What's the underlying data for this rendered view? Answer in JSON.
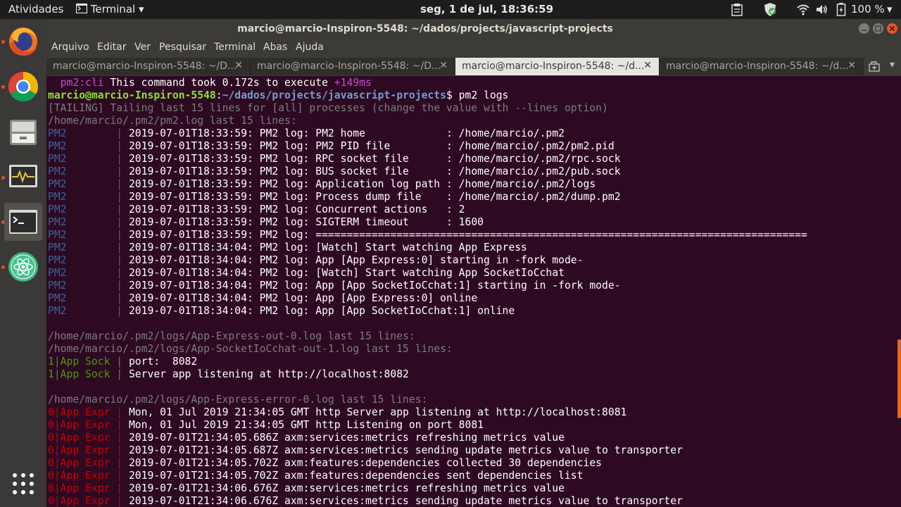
{
  "topbar": {
    "activities": "Atividades",
    "app_menu": "Terminal",
    "app_menu_arrow": "▾",
    "clock": "seg,  1 de jul, 18:36:59",
    "battery": "100 %",
    "tray_arrow": "▾"
  },
  "window": {
    "title": "marcio@marcio-Inspiron-5548: ~/dados/projects/javascript-projects"
  },
  "menu": [
    "Arquivo",
    "Editar",
    "Ver",
    "Pesquisar",
    "Terminal",
    "Abas",
    "Ajuda"
  ],
  "tabs": [
    {
      "label": "marcio@marcio-Inspiron-5548: ~/D...",
      "close": "✕"
    },
    {
      "label": "marcio@marcio-Inspiron-5548: ~/D...",
      "close": "✕"
    },
    {
      "label": "marcio@marcio-Inspiron-5548: ~/d...",
      "close": "✕"
    },
    {
      "label": "marcio@marcio-Inspiron-5548: ~/d...",
      "close": "✕"
    }
  ],
  "tabbar_menu_arrow": "▾",
  "colors": {
    "white": "#ffffff",
    "text": "#d3d7cf",
    "gray": "#7d7d7d",
    "blue": "#3465a4",
    "green": "#4e9a06",
    "red": "#cc0000",
    "magenta": "#c94ad3",
    "prompt_user": "#8ae234",
    "prompt_path": "#729fcf"
  },
  "terminal_lines": [
    [
      {
        "t": "  pm2:cli",
        "c": "magenta"
      },
      {
        "t": " This command took 0.172s to execute ",
        "c": "white"
      },
      {
        "t": "+149ms",
        "c": "magenta"
      }
    ],
    [
      {
        "t": "marcio@marcio-Inspiron-5548",
        "c": "prompt_user"
      },
      {
        "t": ":",
        "c": "white"
      },
      {
        "t": "~/dados/projects/javascript-projects",
        "c": "prompt_path"
      },
      {
        "t": "$ pm2 logs",
        "c": "white"
      }
    ],
    [
      {
        "t": "[TAILING] Tailing last 15 lines for [all] processes (change the value with --lines option)",
        "c": "gray"
      }
    ],
    [
      {
        "t": "/home/marcio/.pm2/pm2.log last 15 lines:",
        "c": "gray"
      }
    ],
    [
      {
        "t": "PM2        ",
        "c": "blue"
      },
      {
        "t": "| ",
        "c": "blue"
      },
      {
        "t": "2019-07-01T18:33:59: PM2 log: PM2 home             : /home/marcio/.pm2",
        "c": "white"
      }
    ],
    [
      {
        "t": "PM2        ",
        "c": "blue"
      },
      {
        "t": "| ",
        "c": "blue"
      },
      {
        "t": "2019-07-01T18:33:59: PM2 log: PM2 PID file         : /home/marcio/.pm2/pm2.pid",
        "c": "white"
      }
    ],
    [
      {
        "t": "PM2        ",
        "c": "blue"
      },
      {
        "t": "| ",
        "c": "blue"
      },
      {
        "t": "2019-07-01T18:33:59: PM2 log: RPC socket file      : /home/marcio/.pm2/rpc.sock",
        "c": "white"
      }
    ],
    [
      {
        "t": "PM2        ",
        "c": "blue"
      },
      {
        "t": "| ",
        "c": "blue"
      },
      {
        "t": "2019-07-01T18:33:59: PM2 log: BUS socket file      : /home/marcio/.pm2/pub.sock",
        "c": "white"
      }
    ],
    [
      {
        "t": "PM2        ",
        "c": "blue"
      },
      {
        "t": "| ",
        "c": "blue"
      },
      {
        "t": "2019-07-01T18:33:59: PM2 log: Application log path : /home/marcio/.pm2/logs",
        "c": "white"
      }
    ],
    [
      {
        "t": "PM2        ",
        "c": "blue"
      },
      {
        "t": "| ",
        "c": "blue"
      },
      {
        "t": "2019-07-01T18:33:59: PM2 log: Process dump file    : /home/marcio/.pm2/dump.pm2",
        "c": "white"
      }
    ],
    [
      {
        "t": "PM2        ",
        "c": "blue"
      },
      {
        "t": "| ",
        "c": "blue"
      },
      {
        "t": "2019-07-01T18:33:59: PM2 log: Concurrent actions   : 2",
        "c": "white"
      }
    ],
    [
      {
        "t": "PM2        ",
        "c": "blue"
      },
      {
        "t": "| ",
        "c": "blue"
      },
      {
        "t": "2019-07-01T18:33:59: PM2 log: SIGTERM timeout      : 1600",
        "c": "white"
      }
    ],
    [
      {
        "t": "PM2        ",
        "c": "blue"
      },
      {
        "t": "| ",
        "c": "blue"
      },
      {
        "t": "2019-07-01T18:33:59: PM2 log: ===============================================================================",
        "c": "white"
      }
    ],
    [
      {
        "t": "PM2        ",
        "c": "blue"
      },
      {
        "t": "| ",
        "c": "blue"
      },
      {
        "t": "2019-07-01T18:34:04: PM2 log: [Watch] Start watching App Express",
        "c": "white"
      }
    ],
    [
      {
        "t": "PM2        ",
        "c": "blue"
      },
      {
        "t": "| ",
        "c": "blue"
      },
      {
        "t": "2019-07-01T18:34:04: PM2 log: App [App Express:0] starting in -fork mode-",
        "c": "white"
      }
    ],
    [
      {
        "t": "PM2        ",
        "c": "blue"
      },
      {
        "t": "| ",
        "c": "blue"
      },
      {
        "t": "2019-07-01T18:34:04: PM2 log: [Watch] Start watching App SocketIoCchat",
        "c": "white"
      }
    ],
    [
      {
        "t": "PM2        ",
        "c": "blue"
      },
      {
        "t": "| ",
        "c": "blue"
      },
      {
        "t": "2019-07-01T18:34:04: PM2 log: App [App SocketIoCchat:1] starting in -fork mode-",
        "c": "white"
      }
    ],
    [
      {
        "t": "PM2        ",
        "c": "blue"
      },
      {
        "t": "| ",
        "c": "blue"
      },
      {
        "t": "2019-07-01T18:34:04: PM2 log: App [App Express:0] online",
        "c": "white"
      }
    ],
    [
      {
        "t": "PM2        ",
        "c": "blue"
      },
      {
        "t": "| ",
        "c": "blue"
      },
      {
        "t": "2019-07-01T18:34:04: PM2 log: App [App SocketIoCchat:1] online",
        "c": "white"
      }
    ],
    [],
    [
      {
        "t": "/home/marcio/.pm2/logs/App-Express-out-0.log last 15 lines:",
        "c": "gray"
      }
    ],
    [
      {
        "t": "/home/marcio/.pm2/logs/App-SocketIoCchat-out-1.log last 15 lines:",
        "c": "gray"
      }
    ],
    [
      {
        "t": "1|App Sock ",
        "c": "green"
      },
      {
        "t": "| ",
        "c": "green"
      },
      {
        "t": "port:  8082",
        "c": "white"
      }
    ],
    [
      {
        "t": "1|App Sock ",
        "c": "green"
      },
      {
        "t": "| ",
        "c": "green"
      },
      {
        "t": "Server app listening at http://localhost:8082",
        "c": "white"
      }
    ],
    [],
    [
      {
        "t": "/home/marcio/.pm2/logs/App-Express-error-0.log last 15 lines:",
        "c": "gray"
      }
    ],
    [
      {
        "t": "0|App Expr ",
        "c": "red"
      },
      {
        "t": "| ",
        "c": "red"
      },
      {
        "t": "Mon, 01 Jul 2019 21:34:05 GMT http Server app listening at http://localhost:8081",
        "c": "white"
      }
    ],
    [
      {
        "t": "0|App Expr ",
        "c": "red"
      },
      {
        "t": "| ",
        "c": "red"
      },
      {
        "t": "Mon, 01 Jul 2019 21:34:05 GMT http Listening on port 8081",
        "c": "white"
      }
    ],
    [
      {
        "t": "0|App Expr ",
        "c": "red"
      },
      {
        "t": "| ",
        "c": "red"
      },
      {
        "t": "2019-07-01T21:34:05.686Z axm:services:metrics refreshing metrics value",
        "c": "white"
      }
    ],
    [
      {
        "t": "0|App Expr ",
        "c": "red"
      },
      {
        "t": "| ",
        "c": "red"
      },
      {
        "t": "2019-07-01T21:34:05.687Z axm:services:metrics sending update metrics value to transporter",
        "c": "white"
      }
    ],
    [
      {
        "t": "0|App Expr ",
        "c": "red"
      },
      {
        "t": "| ",
        "c": "red"
      },
      {
        "t": "2019-07-01T21:34:05.702Z axm:features:dependencies collected 30 dependencies",
        "c": "white"
      }
    ],
    [
      {
        "t": "0|App Expr ",
        "c": "red"
      },
      {
        "t": "| ",
        "c": "red"
      },
      {
        "t": "2019-07-01T21:34:05.702Z axm:features:dependencies sent dependencies list",
        "c": "white"
      }
    ],
    [
      {
        "t": "0|App Expr ",
        "c": "red"
      },
      {
        "t": "| ",
        "c": "red"
      },
      {
        "t": "2019-07-01T21:34:06.676Z axm:services:metrics refreshing metrics value",
        "c": "white"
      }
    ],
    [
      {
        "t": "0|App Expr ",
        "c": "red"
      },
      {
        "t": "| ",
        "c": "red"
      },
      {
        "t": "2019-07-01T21:34:06.676Z axm:services:metrics sending update metrics value to transporter",
        "c": "white"
      }
    ]
  ]
}
